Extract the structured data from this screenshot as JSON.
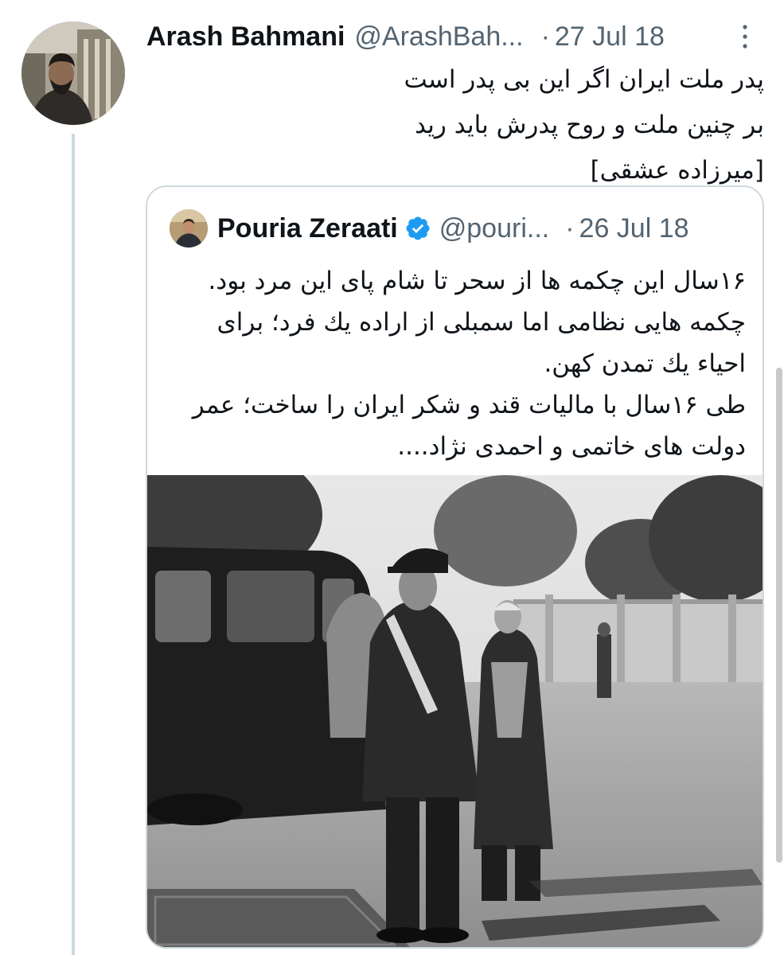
{
  "tweet": {
    "author": {
      "display_name": "Arash Bahmani",
      "handle": "@ArashBah...",
      "avatar_icon": "profile-photo"
    },
    "separator": "·",
    "date": "27 Jul 18",
    "more_icon": "more-vertical-icon",
    "text_lines": [
      "پدر ملت ایران اگر این بی پدر است",
      "بر چنین ملت و روح پدرش باید رید",
      "[میرزاده عشقی]"
    ]
  },
  "quoted_tweet": {
    "author": {
      "display_name": "Pouria Zeraati",
      "handle": "@pouri...",
      "verified": true,
      "verified_icon": "verified-badge-icon"
    },
    "separator": "·",
    "date": "26 Jul 18",
    "text_lines": [
      "۱۶سال این چکمه ها از سحر تا شام پای این مرد بود.",
      "چکمه هایی نظامی اما سمبلی از اراده یك فرد؛ برای",
      "احیاء یك تمدن کهن.",
      "طی ۱۶سال با مالیات قند و شکر ایران را ساخت؛ عمر",
      "دولت های خاتمی و احمدی نژاد...."
    ],
    "photo": "black-and-white historical photo of a uniformed military officer walking beside a vintage car"
  },
  "colors": {
    "text_primary": "#0f1419",
    "text_secondary": "#536471",
    "border": "#cfd9de",
    "verified_blue": "#1d9bf0",
    "background": "#ffffff"
  }
}
